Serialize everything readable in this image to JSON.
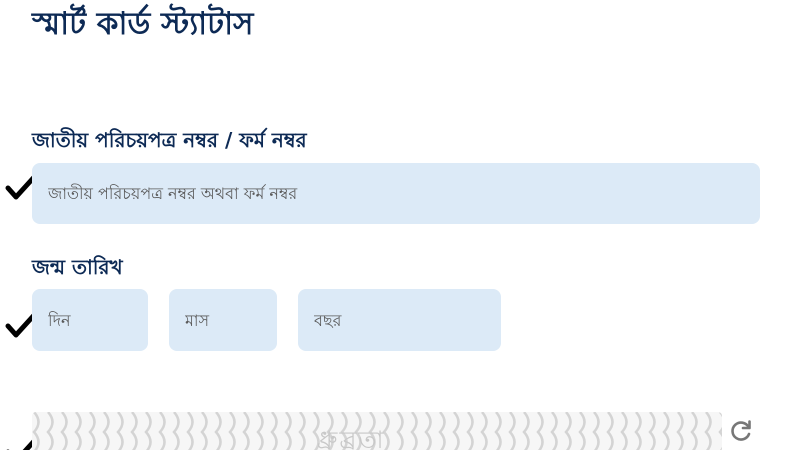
{
  "page": {
    "title": "স্মার্ট কার্ড স্ট্যাটাস"
  },
  "nid_field": {
    "label": "জাতীয় পরিচয়পত্র নম্বর / ফর্ম নম্বর",
    "placeholder": "জাতীয় পরিচয়পত্র নম্বর অথবা ফর্ম নম্বর",
    "value": ""
  },
  "dob_field": {
    "label": "জন্ম তারিখ",
    "day_placeholder": "দিন",
    "month_placeholder": "মাস",
    "year_placeholder": "বছর"
  },
  "captcha": {
    "text": "ধ্রুব্রতা"
  },
  "icons": {
    "check": "check-icon",
    "refresh": "refresh-icon"
  },
  "colors": {
    "title": "#0d2a55",
    "input_bg": "#dceaf7",
    "check": "#000000"
  }
}
